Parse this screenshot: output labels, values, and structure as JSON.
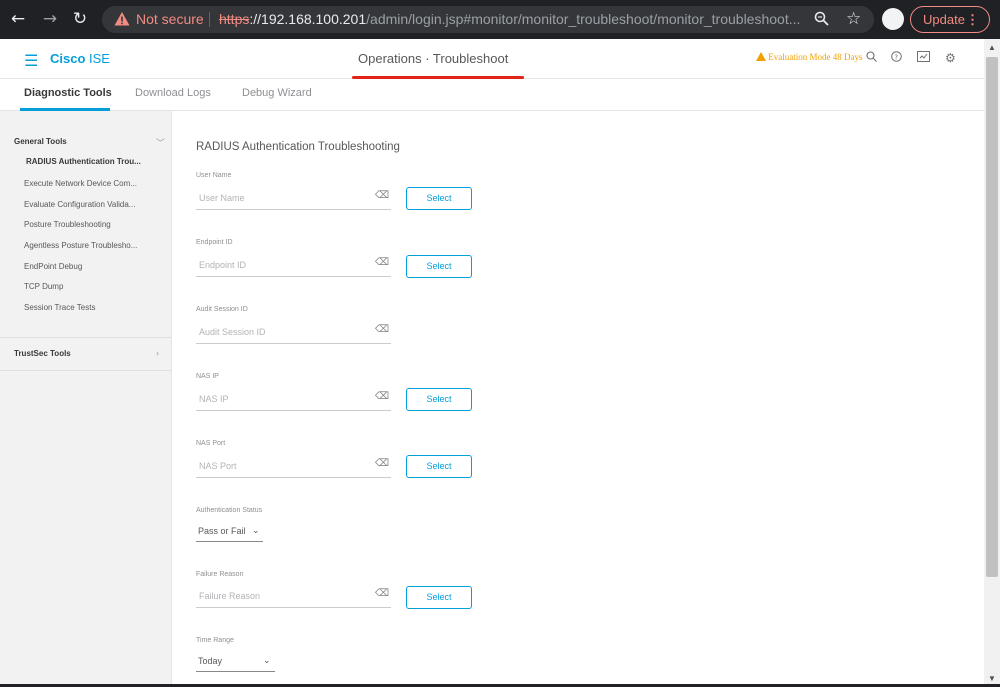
{
  "browser": {
    "not_secure": "Not secure",
    "url_proto": "https",
    "url_host": "://192.168.100.201",
    "url_path": "/admin/login.jsp#monitor/monitor_troubleshoot/monitor_troubleshoot...",
    "update_label": "Update",
    "icons": [
      "back-icon",
      "forward-icon",
      "reload-icon",
      "warning-icon",
      "zoom-icon",
      "star-icon",
      "avatar",
      "menu-dots-icon"
    ],
    "accent": "#f28b82"
  },
  "header": {
    "logo_bold": "Cisco",
    "logo_light": " ISE",
    "title": "Operations · Troubleshoot",
    "evaluation": "Evaluation Mode 48 Days",
    "brand_color": "#049fd9",
    "highlight_color": "#e2231a"
  },
  "tabs": [
    {
      "label": "Diagnostic Tools"
    },
    {
      "label": "Download Logs"
    },
    {
      "label": "Debug Wizard"
    }
  ],
  "sidebar": {
    "general": "General Tools",
    "items": [
      {
        "label": "RADIUS Authentication Trou..."
      },
      {
        "label": "Execute Network Device Com..."
      },
      {
        "label": "Evaluate Configuration Valida..."
      },
      {
        "label": "Posture Troubleshooting"
      },
      {
        "label": "Agentless Posture Troublesho..."
      },
      {
        "label": "EndPoint Debug"
      },
      {
        "label": "TCP Dump"
      },
      {
        "label": "Session Trace Tests"
      }
    ],
    "trustsec": "TrustSec Tools"
  },
  "main": {
    "title": "RADIUS Authentication Troubleshooting",
    "select_label": "Select",
    "fields": [
      {
        "label": "User Name",
        "placeholder": "User Name"
      },
      {
        "label": "Endpoint ID",
        "placeholder": "Endpoint ID"
      },
      {
        "label": "Audit Session ID",
        "placeholder": "Audit Session ID"
      },
      {
        "label": "NAS IP",
        "placeholder": "NAS IP"
      },
      {
        "label": "NAS Port",
        "placeholder": "NAS Port"
      },
      {
        "label": "Failure Reason",
        "placeholder": "Failure Reason"
      }
    ],
    "auth_status": {
      "label": "Authentication Status",
      "value": "Pass or Fail"
    },
    "time_range": {
      "label": "Time Range",
      "value": "Today"
    }
  }
}
